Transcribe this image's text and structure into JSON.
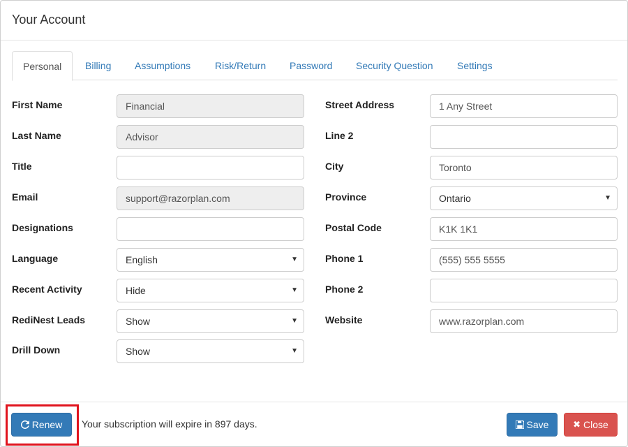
{
  "modal": {
    "title": "Your Account"
  },
  "tabs": [
    {
      "label": "Personal",
      "active": true
    },
    {
      "label": "Billing",
      "active": false
    },
    {
      "label": "Assumptions",
      "active": false
    },
    {
      "label": "Risk/Return",
      "active": false
    },
    {
      "label": "Password",
      "active": false
    },
    {
      "label": "Security Question",
      "active": false
    },
    {
      "label": "Settings",
      "active": false
    }
  ],
  "left_fields": {
    "first_name": {
      "label": "First Name",
      "value": "Financial"
    },
    "last_name": {
      "label": "Last Name",
      "value": "Advisor"
    },
    "title": {
      "label": "Title",
      "value": ""
    },
    "email": {
      "label": "Email",
      "value": "support@razorplan.com"
    },
    "designations": {
      "label": "Designations",
      "value": ""
    },
    "language": {
      "label": "Language",
      "value": "English"
    },
    "recent_activity": {
      "label": "Recent Activity",
      "value": "Hide"
    },
    "redinest_leads": {
      "label": "RediNest Leads",
      "value": "Show"
    },
    "drill_down": {
      "label": "Drill Down",
      "value": "Show"
    }
  },
  "right_fields": {
    "street_address": {
      "label": "Street Address",
      "value": "1 Any Street"
    },
    "line2": {
      "label": "Line 2",
      "value": ""
    },
    "city": {
      "label": "City",
      "value": "Toronto"
    },
    "province": {
      "label": "Province",
      "value": "Ontario"
    },
    "postal_code": {
      "label": "Postal Code",
      "value": "K1K 1K1"
    },
    "phone1": {
      "label": "Phone 1",
      "value": "(555) 555 5555"
    },
    "phone2": {
      "label": "Phone 2",
      "value": ""
    },
    "website": {
      "label": "Website",
      "value": "www.razorplan.com"
    }
  },
  "footer": {
    "renew_label": "Renew",
    "expiry_text": "Your subscription will expire in 897 days.",
    "save_label": "Save",
    "close_label": "Close"
  },
  "icons": {
    "renew": "refresh-icon",
    "save": "floppy-disk-icon",
    "close": "close-icon",
    "dropdown": "caret-down-icon"
  },
  "colors": {
    "primary": "#337ab7",
    "danger": "#d9534f",
    "link": "#337ab7",
    "highlight": "#e0141e",
    "readonly_bg": "#eeeeee"
  }
}
